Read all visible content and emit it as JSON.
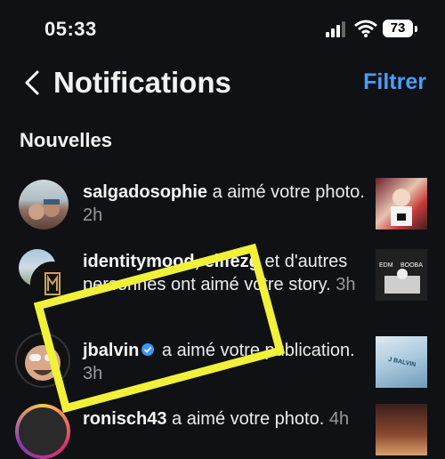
{
  "status": {
    "time": "05:33",
    "battery": "73"
  },
  "header": {
    "title": "Notifications",
    "filter_label": "Filtrer"
  },
  "section": {
    "label": "Nouvelles"
  },
  "notifications": [
    {
      "user": "salgadosophie",
      "message": " a aimé votre photo.",
      "time": "2h"
    },
    {
      "user": "identitymood, elifezg",
      "message": " et d'autres personnes ont aimé votre story.",
      "time": "3h"
    },
    {
      "user": "jbalvin",
      "message": " a aimé votre publication.",
      "time": "3h"
    },
    {
      "user": "ronisch43",
      "message": " a aimé votre photo.",
      "time": "4h"
    }
  ],
  "thumb_text": {
    "t2a": "EDM",
    "t2b": "BOOBA",
    "t3": "J BALVIN"
  },
  "colors": {
    "background": "#0f1115",
    "accent": "#4a9df8",
    "highlight": "#f1f13a"
  }
}
